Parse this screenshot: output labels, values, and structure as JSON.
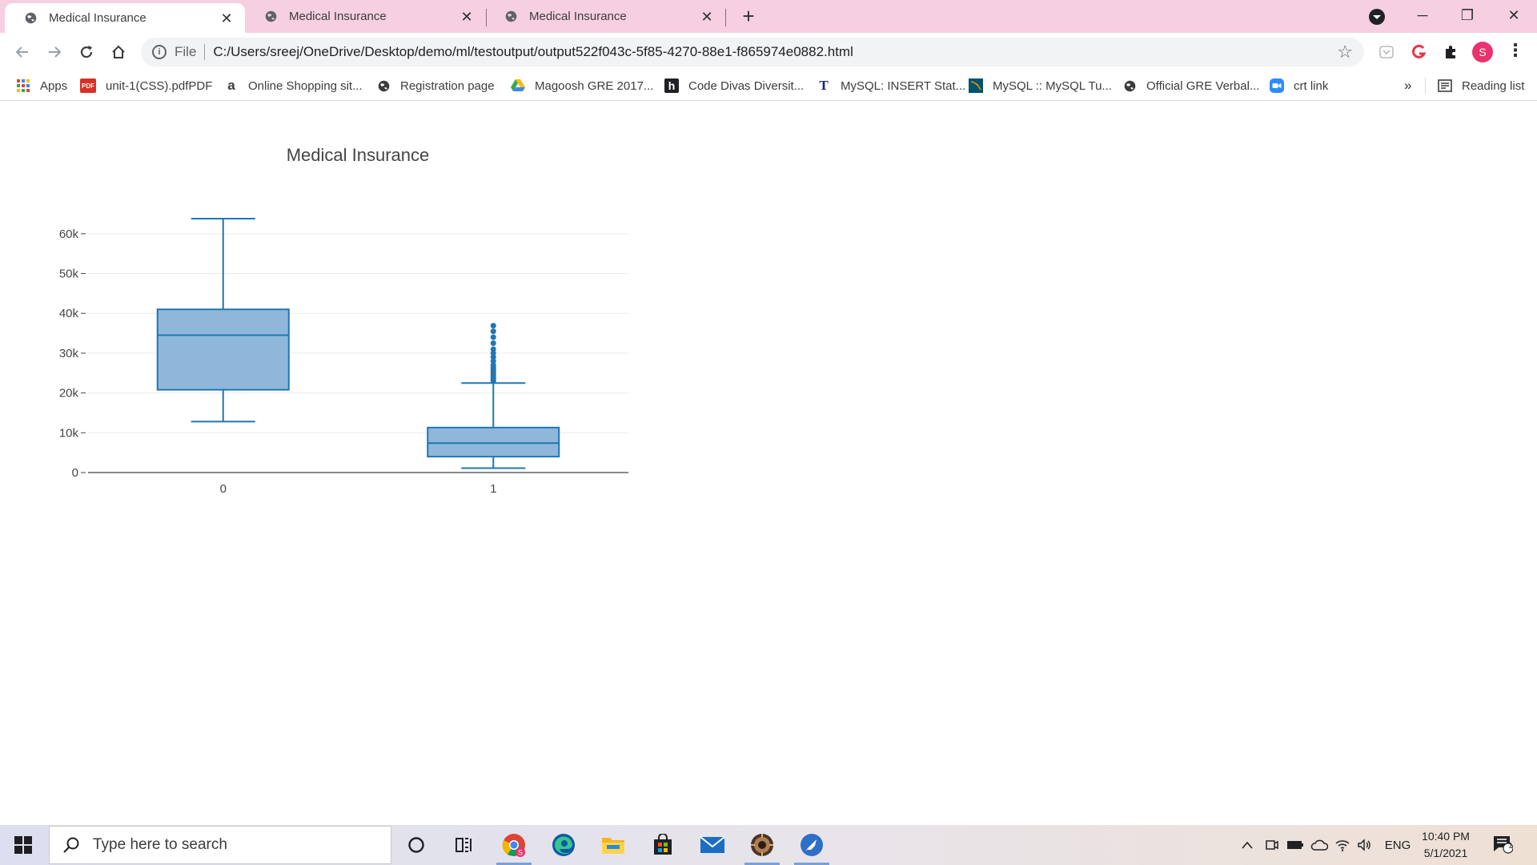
{
  "tabs": [
    {
      "title": "Medical Insurance",
      "active": true
    },
    {
      "title": "Medical Insurance",
      "active": false
    },
    {
      "title": "Medical Insurance",
      "active": false
    }
  ],
  "toolbar": {
    "file_label": "File",
    "url": "C:/Users/sreej/OneDrive/Desktop/demo/ml/testoutput/output522f043c-5f85-4270-88e1-f865974e0882.html",
    "profile_initial": "S"
  },
  "bookmarks": [
    {
      "label": "Apps",
      "icon": "apps-grid-icon"
    },
    {
      "label": "unit-1(CSS).pdfPDF",
      "icon": "pdf-icon",
      "icon_text": "PDF"
    },
    {
      "label": "Online Shopping sit...",
      "icon": "amazon-icon",
      "icon_text": "a"
    },
    {
      "label": "Registration page",
      "icon": "globe-icon"
    },
    {
      "label": "Magoosh GRE 2017...",
      "icon": "google-drive-icon"
    },
    {
      "label": "Code Divas Diversit...",
      "icon": "h-logo-icon",
      "icon_text": "h"
    },
    {
      "label": "MySQL: INSERT Stat...",
      "icon": "t-logo-icon",
      "icon_text": "T"
    },
    {
      "label": "MySQL :: MySQL Tu...",
      "icon": "mysql-icon"
    },
    {
      "label": "Official GRE Verbal...",
      "icon": "globe-icon"
    },
    {
      "label": "crt link",
      "icon": "zoom-icon"
    }
  ],
  "bookmarks_more": "»",
  "reading_list": "Reading list",
  "chart_data": {
    "type": "box",
    "title": "Medical Insurance",
    "categories": [
      "0",
      "1"
    ],
    "boxes": [
      {
        "category": "0",
        "lower_fence": 12800,
        "q1": 20800,
        "median": 34500,
        "q3": 41000,
        "upper_fence": 63800,
        "outliers": []
      },
      {
        "category": "1",
        "lower_fence": 1100,
        "q1": 4000,
        "median": 7400,
        "q3": 11300,
        "upper_fence": 22500,
        "outliers": [
          23000,
          23500,
          24000,
          24500,
          25000,
          25500,
          26000,
          26500,
          27000,
          28000,
          29000,
          30000,
          31000,
          32500,
          34000,
          35500,
          36900
        ]
      }
    ],
    "ylim": [
      0,
      65000
    ],
    "yticks": [
      0,
      10000,
      20000,
      30000,
      40000,
      50000,
      60000
    ],
    "ytick_labels": [
      "0",
      "10k",
      "20k",
      "30k",
      "40k",
      "50k",
      "60k"
    ],
    "grid": true,
    "color": "#1f77b4",
    "fill": "#8fb7d9"
  },
  "taskbar": {
    "search_placeholder": "Type here to search",
    "apps": [
      "cortana-icon",
      "task-view-icon",
      "chrome-icon",
      "edge-icon",
      "file-explorer-icon",
      "store-icon",
      "mail-icon",
      "game-icon",
      "rocket-app-icon"
    ],
    "language": "ENG",
    "time": "10:40 PM",
    "date": "5/1/2021",
    "notification_count": "1"
  }
}
